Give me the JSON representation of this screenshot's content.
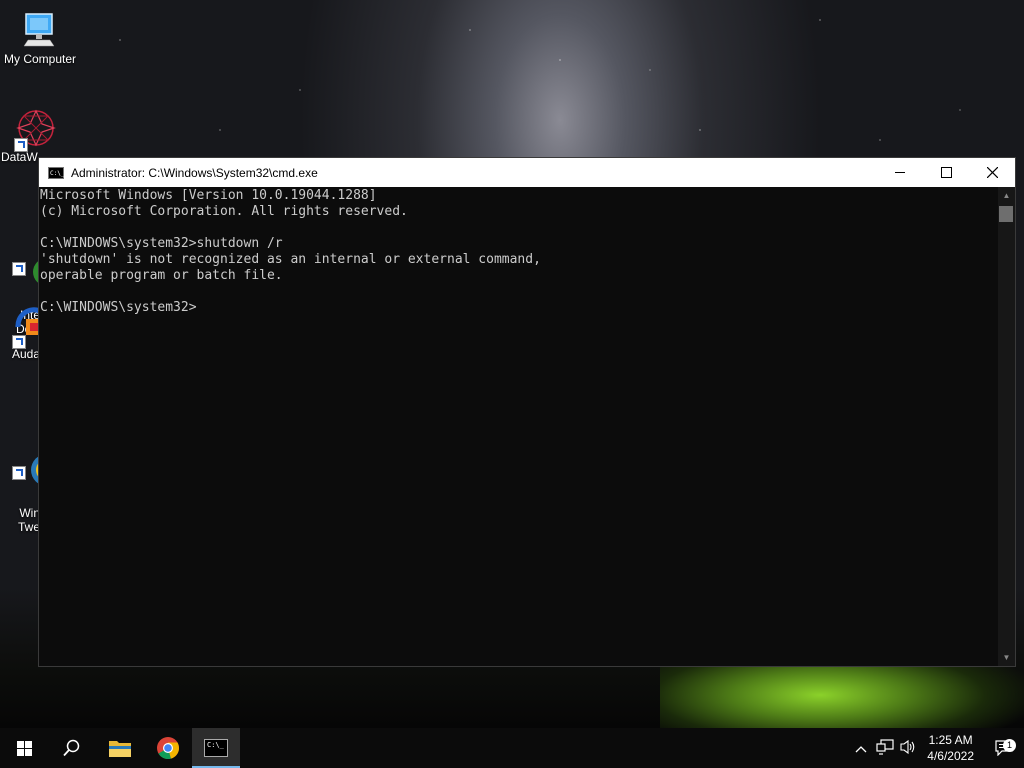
{
  "desktop": {
    "icons": [
      {
        "label": "My Computer",
        "icon": "computer-icon"
      },
      {
        "label": "DataW",
        "icon": "datawrapper-icon"
      },
      {
        "label": "Inte\nDow",
        "icon": "download-manager-icon"
      },
      {
        "label": "Auda",
        "icon": "audacity-icon"
      },
      {
        "label": "Win\nTwe",
        "icon": "tweaker-icon"
      }
    ]
  },
  "window": {
    "title": "Administrator: C:\\Windows\\System32\\cmd.exe",
    "icon": "cmd-icon",
    "controls": {
      "minimize": "minimize-icon",
      "maximize": "maximize-icon",
      "close": "close-icon"
    }
  },
  "console": {
    "lines": [
      "Microsoft Windows [Version 10.0.19044.1288]",
      "(c) Microsoft Corporation. All rights reserved.",
      "",
      "C:\\WINDOWS\\system32>shutdown /r",
      "'shutdown' is not recognized as an internal or external command,",
      "operable program or batch file.",
      "",
      "C:\\WINDOWS\\system32>"
    ]
  },
  "taskbar": {
    "apps": [
      {
        "name": "search",
        "icon": "search-icon"
      },
      {
        "name": "file-explorer",
        "icon": "folder-icon"
      },
      {
        "name": "chrome",
        "icon": "chrome-icon"
      },
      {
        "name": "cmd",
        "icon": "cmd-icon",
        "active": true
      }
    ],
    "tray": {
      "icons": [
        "chevron-up-icon",
        "network-icon",
        "volume-icon"
      ],
      "time": "1:25 AM",
      "date": "4/6/2022",
      "notification_count": "1"
    }
  },
  "colors": {
    "console_bg": "#0c0c0c",
    "console_text": "#cccccc",
    "taskbar_bg": "#0b0b0b",
    "accent": "#76b9ed"
  }
}
